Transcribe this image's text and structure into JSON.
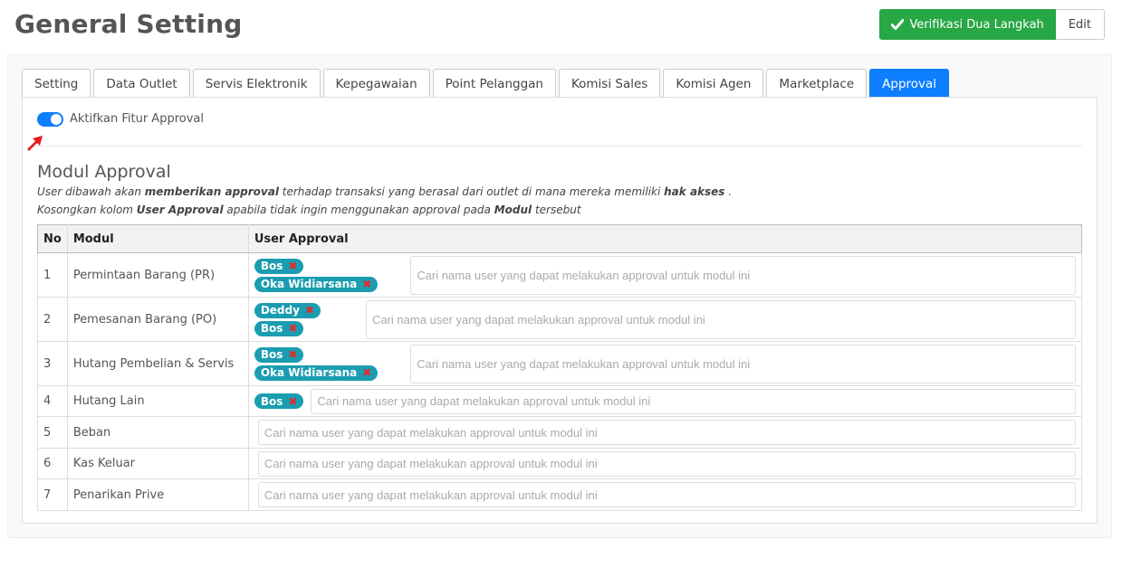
{
  "header": {
    "title": "General Setting",
    "verify_label": "Verifikasi Dua Langkah",
    "edit_label": "Edit"
  },
  "tabs": [
    {
      "label": "Setting",
      "active": false
    },
    {
      "label": "Data Outlet",
      "active": false
    },
    {
      "label": "Servis Elektronik",
      "active": false
    },
    {
      "label": "Kepegawaian",
      "active": false
    },
    {
      "label": "Point Pelanggan",
      "active": false
    },
    {
      "label": "Komisi Sales",
      "active": false
    },
    {
      "label": "Komisi Agen",
      "active": false
    },
    {
      "label": "Marketplace",
      "active": false
    },
    {
      "label": "Approval",
      "active": true
    }
  ],
  "approval": {
    "toggle_label": "Aktifkan Fitur Approval",
    "toggle_on": true,
    "section_title": "Modul Approval",
    "desc1": {
      "a": "User dibawah akan ",
      "b": "memberikan approval",
      "c": " terhadap transaksi yang berasal dari outlet di mana mereka memiliki ",
      "d": "hak akses",
      "e": " ."
    },
    "desc2": {
      "a": "Kosongkan kolom ",
      "b": "User Approval",
      "c": " apabila tidak ingin menggunakan approval pada ",
      "d": "Modul",
      "e": " tersebut"
    },
    "table": {
      "headers": {
        "no": "No",
        "modul": "Modul",
        "user": "User Approval"
      },
      "placeholder": "Cari nama user yang dapat melakukan approval untuk modul ini",
      "remove_symbol": "✖",
      "rows": [
        {
          "no": "1",
          "modul": "Permintaan Barang (PR)",
          "users": [
            "Bos",
            "Oka Widiarsana"
          ]
        },
        {
          "no": "2",
          "modul": "Pemesanan Barang (PO)",
          "users": [
            "Deddy",
            "Bos"
          ]
        },
        {
          "no": "3",
          "modul": "Hutang Pembelian & Servis",
          "users": [
            "Bos",
            "Oka Widiarsana"
          ]
        },
        {
          "no": "4",
          "modul": "Hutang Lain",
          "users": [
            "Bos"
          ]
        },
        {
          "no": "5",
          "modul": "Beban",
          "users": []
        },
        {
          "no": "6",
          "modul": "Kas Keluar",
          "users": []
        },
        {
          "no": "7",
          "modul": "Penarikan Prive",
          "users": []
        }
      ]
    }
  },
  "colors": {
    "accent": "#0d7efd",
    "success": "#28a745",
    "tag": "#1a9db0",
    "tag_remove": "#e02b2b",
    "annotation_arrow": "#e81c1c"
  },
  "icons": {
    "verify": "check-icon",
    "annotation": "red-arrow-icon",
    "remove": "remove-x-icon"
  }
}
